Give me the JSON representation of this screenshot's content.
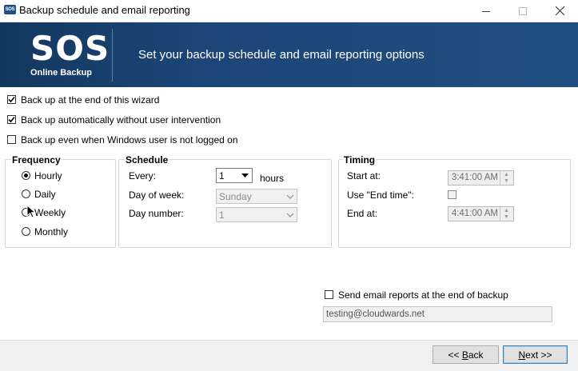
{
  "window": {
    "title": "Backup schedule and email reporting",
    "app_icon_text": "SOS"
  },
  "banner": {
    "logo_main": "SOS",
    "logo_sub": "Online Backup",
    "heading": "Set your backup schedule and email reporting options"
  },
  "options": [
    {
      "label": "Back up at the end of this wizard",
      "checked": true
    },
    {
      "label": "Back up automatically without user intervention",
      "checked": true
    },
    {
      "label": "Back up even when Windows user is not logged on",
      "checked": false
    }
  ],
  "frequency": {
    "title": "Frequency",
    "items": [
      {
        "label": "Hourly",
        "selected": true
      },
      {
        "label": "Daily",
        "selected": false
      },
      {
        "label": "Weekly",
        "selected": false
      },
      {
        "label": "Monthly",
        "selected": false
      }
    ]
  },
  "schedule": {
    "title": "Schedule",
    "every_label": "Every:",
    "every_value": "1",
    "every_unit": "hours",
    "day_of_week_label": "Day of week:",
    "day_of_week_value": "Sunday",
    "day_number_label": "Day number:",
    "day_number_value": "1"
  },
  "timing": {
    "title": "Timing",
    "start_label": "Start at:",
    "start_value": "3:41:00 AM",
    "use_end_label": "Use \"End time\":",
    "use_end_checked": false,
    "end_label": "End at:",
    "end_value": "4:41:00 AM"
  },
  "email": {
    "checkbox_label": "Send email reports at the end of backup",
    "checked": false,
    "address": "testing@cloudwards.net"
  },
  "footer": {
    "back_pre": "<< ",
    "back_accel": "B",
    "back_rest": "ack",
    "next_accel": "N",
    "next_rest": "ext >>"
  }
}
